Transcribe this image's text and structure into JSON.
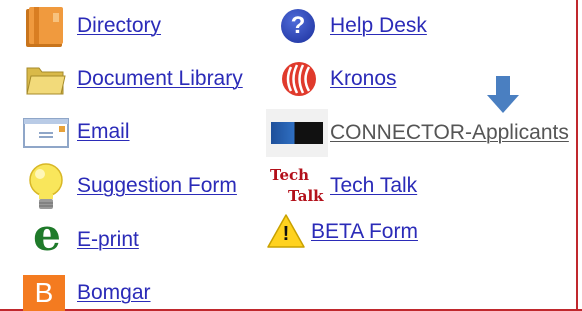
{
  "links": {
    "directory": "Directory",
    "document_library": "Document Library",
    "email": "Email",
    "suggestion_form": "Suggestion Form",
    "eprint": "E-print",
    "bomgar": "Bomgar",
    "help_desk": "Help Desk",
    "kronos": "Kronos",
    "connector": "CONNECTOR-Applicants",
    "tech_talk": "Tech Talk",
    "beta_form": "BETA Form"
  },
  "icon_glyphs": {
    "help_desk": "?",
    "eprint": "e",
    "bomgar": "B",
    "beta_form": "!",
    "tech_talk_top": "Tech",
    "tech_talk_bottom": "Talk"
  },
  "icons": {
    "directory": "book-icon",
    "document_library": "folder-icon",
    "email": "envelope-icon",
    "suggestion_form": "lightbulb-icon",
    "eprint": "eprint-icon",
    "bomgar": "bomgar-icon",
    "help_desk": "help-icon",
    "kronos": "kronos-icon",
    "connector": "connector-logo-icon",
    "tech_talk": "tech-talk-icon",
    "beta_form": "warning-icon",
    "annotation_arrow": "arrow-down-icon"
  },
  "colors": {
    "link": "#2b2bb8",
    "visited_link": "#555555",
    "frame_border": "#c0282d",
    "arrow": "#4a7fc1"
  }
}
